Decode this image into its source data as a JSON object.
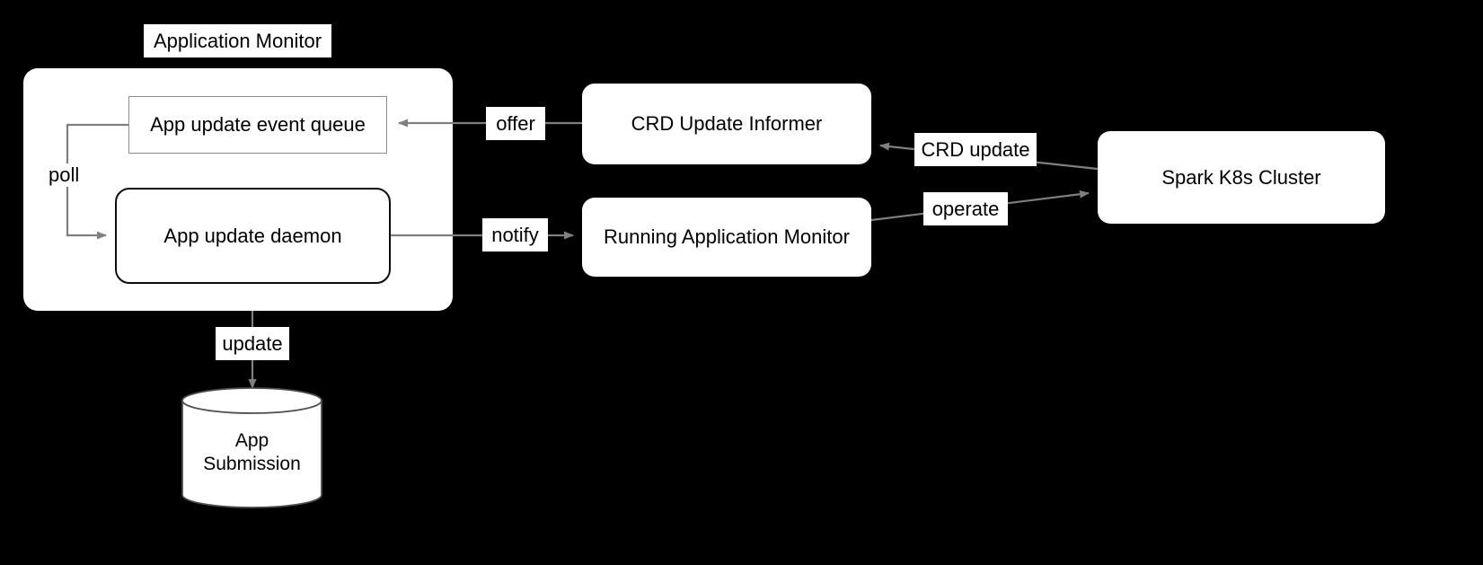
{
  "diagram": {
    "title_label": "Application Monitor",
    "background_color": "#000000",
    "node_fill": "#ffffff",
    "edge_color": "#7f7f7f",
    "nodes": {
      "outer_container": {
        "label": "Application Monitor",
        "shape": "rounded-rect"
      },
      "event_queue": {
        "label": "App update event queue",
        "shape": "rect",
        "border_color": "#8c8c8c"
      },
      "daemon": {
        "label": "App update daemon",
        "shape": "rounded-rect",
        "border_color": "#0d0d0d"
      },
      "informer": {
        "label": "CRD Update Informer",
        "shape": "rounded-rect"
      },
      "running_monitor": {
        "label": "Running Application Monitor",
        "shape": "rounded-rect"
      },
      "spark_cluster": {
        "label": "Spark K8s Cluster",
        "shape": "rounded-rect"
      },
      "app_submission": {
        "label": "App\nSubmission",
        "shape": "cylinder"
      }
    },
    "edges": [
      {
        "id": "offer",
        "label": "offer",
        "from": "informer",
        "to": "event_queue"
      },
      {
        "id": "poll",
        "label": "poll",
        "from": "event_queue",
        "to": "daemon"
      },
      {
        "id": "notify",
        "label": "notify",
        "from": "daemon",
        "to": "running_monitor"
      },
      {
        "id": "crd_update",
        "label": "CRD update",
        "from": "spark_cluster",
        "to": "informer"
      },
      {
        "id": "operate",
        "label": "operate",
        "from": "running_monitor",
        "to": "spark_cluster"
      },
      {
        "id": "update",
        "label": "update",
        "from": "daemon",
        "to": "app_submission"
      }
    ]
  }
}
